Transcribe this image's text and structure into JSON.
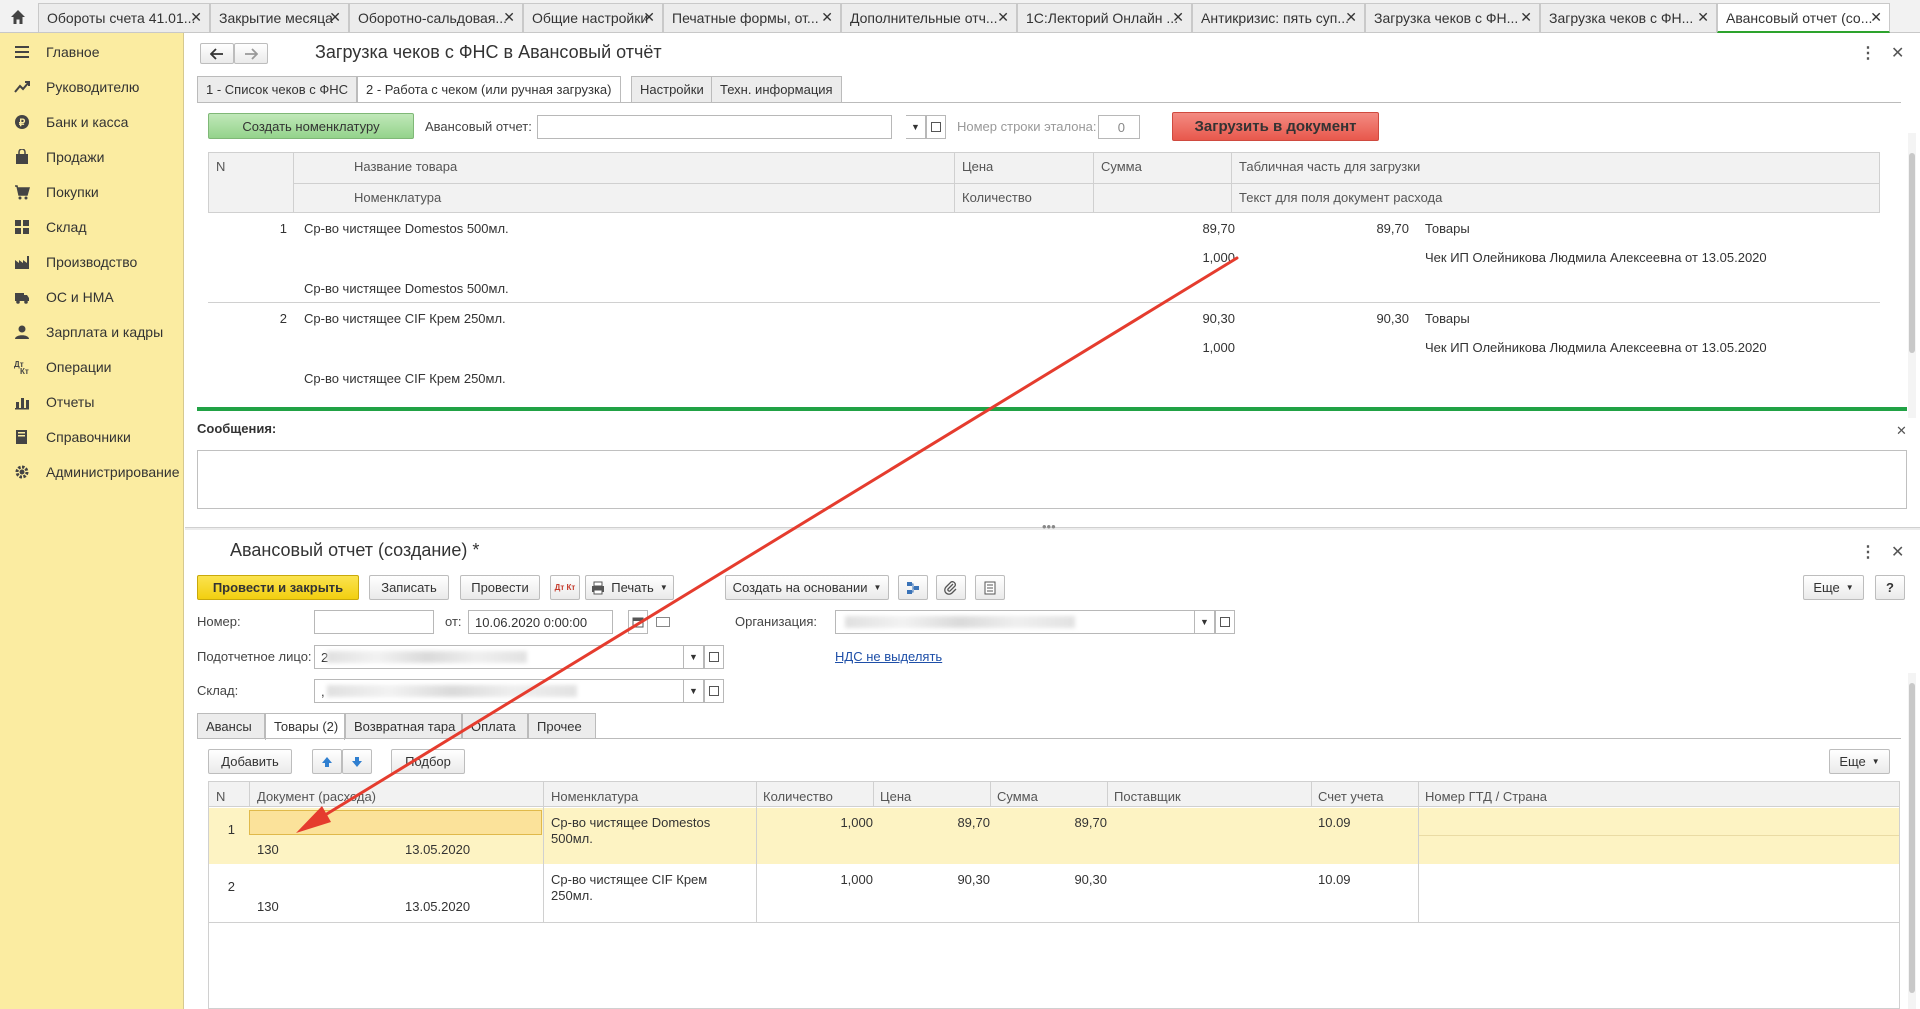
{
  "tabs": [
    {
      "label": "Обороты счета 41.01...",
      "active": false
    },
    {
      "label": "Закрытие месяца",
      "active": false
    },
    {
      "label": "Оборотно-сальдовая...",
      "active": false
    },
    {
      "label": "Общие настройки",
      "active": false
    },
    {
      "label": "Печатные формы, от...",
      "active": false
    },
    {
      "label": "Дополнительные отч...",
      "active": false
    },
    {
      "label": "1С:Лекторий Онлайн ...",
      "active": false
    },
    {
      "label": "Антикризис: пять суп...",
      "active": false
    },
    {
      "label": "Загрузка чеков с ФН...",
      "active": false
    },
    {
      "label": "Загрузка чеков с ФН...",
      "active": false
    },
    {
      "label": "Авансовый отчет (со...",
      "active": true
    }
  ],
  "tab_close": "✕",
  "sidebar": {
    "items": [
      {
        "label": "Главное",
        "icon": "menu-icon"
      },
      {
        "label": "Руководителю",
        "icon": "trend-icon"
      },
      {
        "label": "Банк и касса",
        "icon": "coin-icon"
      },
      {
        "label": "Продажи",
        "icon": "bag-icon"
      },
      {
        "label": "Покупки",
        "icon": "cart-icon"
      },
      {
        "label": "Склад",
        "icon": "warehouse-icon"
      },
      {
        "label": "Производство",
        "icon": "factory-icon"
      },
      {
        "label": "ОС и НМА",
        "icon": "truck-icon"
      },
      {
        "label": "Зарплата и кадры",
        "icon": "person-icon"
      },
      {
        "label": "Операции",
        "icon": "dt-kt-icon"
      },
      {
        "label": "Отчеты",
        "icon": "chart-icon"
      },
      {
        "label": "Справочники",
        "icon": "book-icon"
      },
      {
        "label": "Администрирование",
        "icon": "gear-icon"
      }
    ]
  },
  "loader": {
    "title": "Загрузка чеков с ФНС в Авансовый отчёт",
    "form_tabs": [
      {
        "label": "1 - Список чеков с ФНС",
        "active": false
      },
      {
        "label": "2 - Работа с чеком (или ручная загрузка)",
        "active": true
      },
      {
        "label": "Настройки",
        "active": false
      },
      {
        "label": "Техн. информация",
        "active": false
      }
    ],
    "create_nomenclature_label": "Создать номенклатуру",
    "advance_report_label": "Авансовый отчет:",
    "advance_report_value": "",
    "row_number_label": "Номер строки эталона:",
    "row_number_value": "0",
    "load_button_label": "Загрузить в документ",
    "table": {
      "headers": {
        "n": "N",
        "name": "Название товара",
        "nomenclature": "Номенклатура",
        "price": "Цена",
        "qty": "Количество",
        "sum": "Сумма",
        "tabular": "Табличная часть для загрузки",
        "expense_text": "Текст для поля документ расхода"
      },
      "rows": [
        {
          "n": "1",
          "name": "Ср-во чистящее Domestos 500мл.",
          "price": "89,70",
          "qty": "1,000",
          "sum": "89,70",
          "tabular": "Товары",
          "expense_text": "Чек ИП Олейникова Людмила Алексеевна от 13.05.2020",
          "nomenclature": "Ср-во чистящее Domestos 500мл."
        },
        {
          "n": "2",
          "name": "Ср-во чистящее CIF Крем 250мл.",
          "price": "90,30",
          "qty": "1,000",
          "sum": "90,30",
          "tabular": "Товары",
          "expense_text": "Чек ИП Олейникова Людмила Алексеевна от 13.05.2020",
          "nomenclature": "Ср-во чистящее CIF Крем 250мл."
        }
      ]
    }
  },
  "messages": {
    "title": "Сообщения:"
  },
  "report": {
    "title": "Авансовый отчет (создание) *",
    "post_close_label": "Провести и закрыть",
    "save_label": "Записать",
    "post_label": "Провести",
    "dtkt_label": "Дт Кт",
    "print_label": "Печать",
    "create_based_label": "Создать на основании",
    "more_label": "Еще",
    "help_label": "?",
    "number_label": "Номер:",
    "number_value": "",
    "from_label": "от:",
    "date_value": "10.06.2020  0:00:00",
    "org_label": "Организация:",
    "person_label": "Подотчетное лицо:",
    "person_value": "2",
    "vat_link": "НДС не выделять",
    "warehouse_label": "Склад:",
    "warehouse_value": ",",
    "doc_tabs": [
      {
        "label": "Авансы",
        "active": false
      },
      {
        "label": "Товары (2)",
        "active": true
      },
      {
        "label": "Возвратная тара",
        "active": false
      },
      {
        "label": "Оплата",
        "active": false
      },
      {
        "label": "Прочее",
        "active": false
      }
    ],
    "add_label": "Добавить",
    "pick_label": "Подбор",
    "goods_more_label": "Еще",
    "goods_table": {
      "headers": {
        "n": "N",
        "doc": "Документ (расхода)",
        "nomenclature": "Номенклатура",
        "qty": "Количество",
        "price": "Цена",
        "sum": "Сумма",
        "supplier": "Поставщик",
        "account": "Счет учета",
        "gtd": "Номер ГТД / Страна"
      },
      "rows": [
        {
          "n": "1",
          "doc": "",
          "doc_number": "130",
          "doc_date": "13.05.2020",
          "nomenclature_line1": "Ср-во чистящее Domestos",
          "nomenclature_line2": "500мл.",
          "qty": "1,000",
          "price": "89,70",
          "sum": "89,70",
          "supplier": "",
          "account": "10.09",
          "gtd": ""
        },
        {
          "n": "2",
          "doc": "",
          "doc_number": "130",
          "doc_date": "13.05.2020",
          "nomenclature_line1": "Ср-во чистящее CIF Крем",
          "nomenclature_line2": "250мл.",
          "qty": "1,000",
          "price": "90,30",
          "sum": "90,30",
          "supplier": "",
          "account": "10.09",
          "gtd": ""
        }
      ]
    }
  },
  "colors": {
    "sidebar_bg": "#fbeca1",
    "primary_button": "#f7d520",
    "load_button": "#ee6a5f",
    "create_button": "#a6dba0",
    "divider_green": "#21a245",
    "selected_row": "#fdf3c3",
    "selected_cell": "#fbe29a",
    "arrow": "#e53c2e"
  }
}
